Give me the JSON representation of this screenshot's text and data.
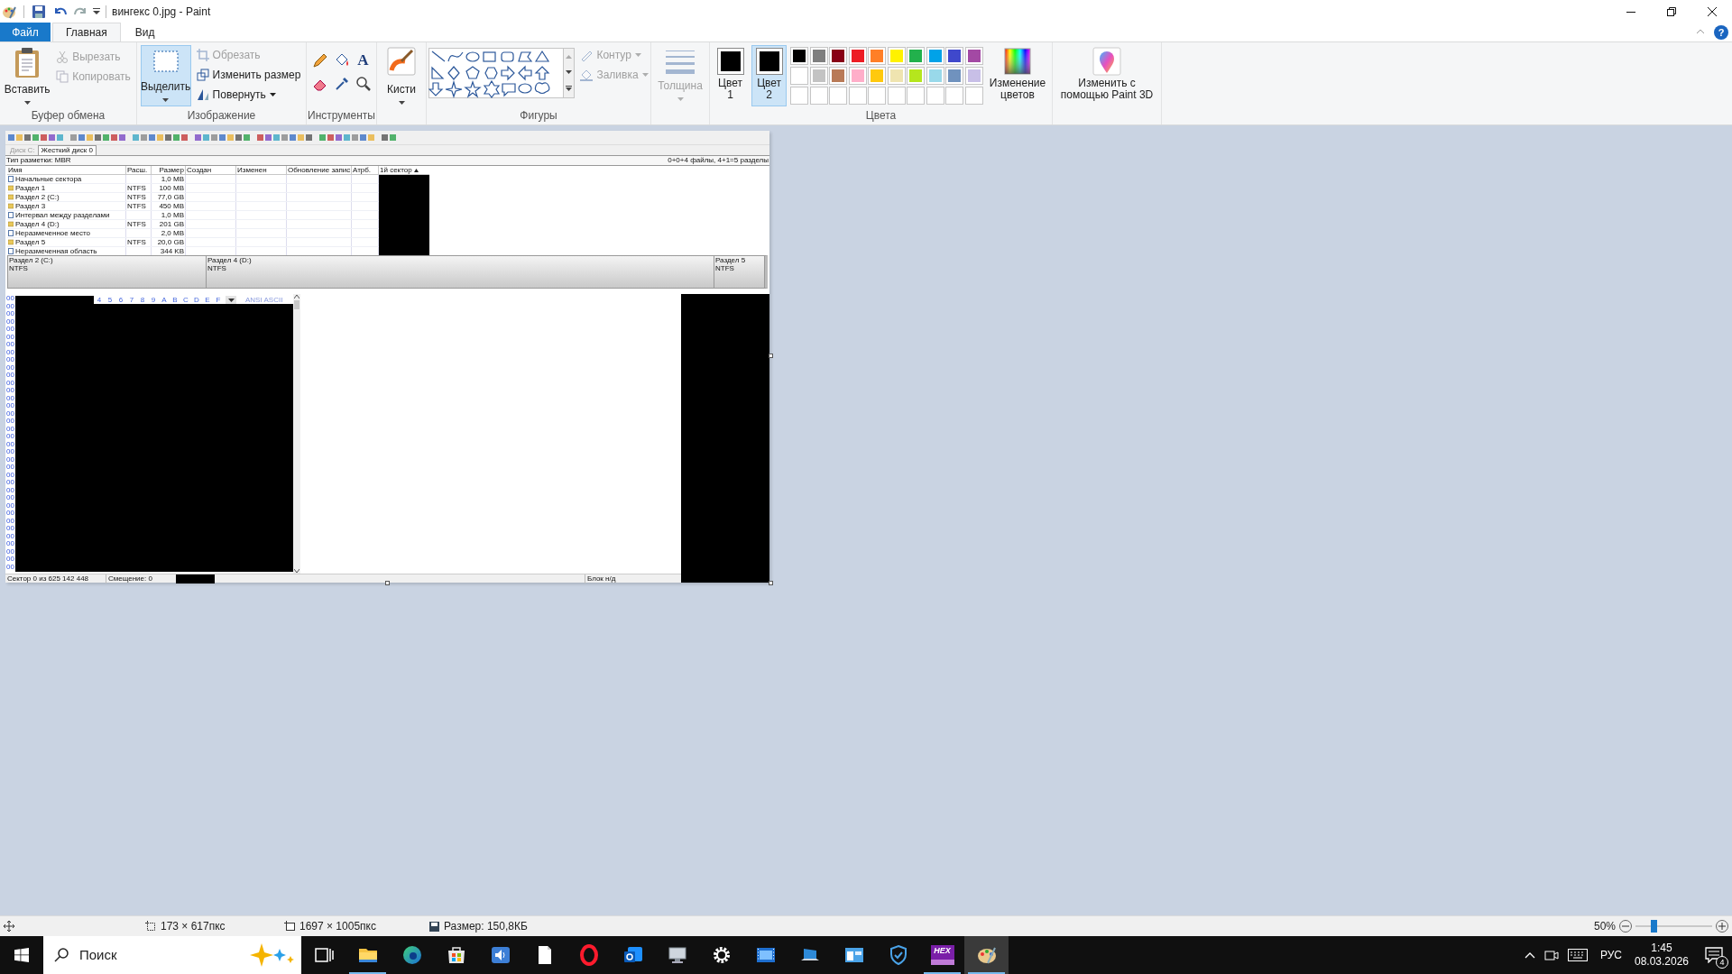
{
  "window": {
    "title": "вингекс 0.jpg - Paint",
    "help": "?"
  },
  "menu_tabs": [
    {
      "label": "Файл",
      "kind": "file",
      "selected": false
    },
    {
      "label": "Главная",
      "kind": "tab",
      "selected": true
    },
    {
      "label": "Вид",
      "kind": "tab",
      "selected": false
    }
  ],
  "clipboard": {
    "label": "Буфер обмена",
    "paste": "Вставить",
    "cut": {
      "label": "Вырезать",
      "disabled": true
    },
    "copy": {
      "label": "Копировать",
      "disabled": true
    }
  },
  "image": {
    "label": "Изображение",
    "select": {
      "label": "Выделить",
      "selected": true
    },
    "crop": {
      "label": "Обрезать",
      "disabled": true
    },
    "resize": {
      "label": "Изменить размер",
      "disabled": false
    },
    "rotate": {
      "label": "Повернуть",
      "disabled": false
    }
  },
  "tools": {
    "label": "Инструменты",
    "text_tool": "A"
  },
  "brushes": {
    "button": "Кисти"
  },
  "shapes": {
    "label": "Фигуры",
    "outline": {
      "label": "Контур",
      "disabled": true
    },
    "fill": {
      "label": "Заливка",
      "disabled": true
    }
  },
  "size": {
    "button": "Толщина",
    "disabled": true
  },
  "colors": {
    "label": "Цвета",
    "color1": {
      "label": "Цвет 1",
      "color": "#000000",
      "selected": false
    },
    "color2": {
      "label": "Цвет 2",
      "color": "#000000",
      "selected": true
    },
    "palette": [
      {
        "kind": "color",
        "color": "#000000"
      },
      {
        "kind": "color",
        "color": "#7f7f7f"
      },
      {
        "kind": "color",
        "color": "#880015"
      },
      {
        "kind": "color",
        "color": "#ed1c24"
      },
      {
        "kind": "color",
        "color": "#ff7f27"
      },
      {
        "kind": "color",
        "color": "#fff200"
      },
      {
        "kind": "color",
        "color": "#22b14c"
      },
      {
        "kind": "color",
        "color": "#00a2e8"
      },
      {
        "kind": "color",
        "color": "#3f48cc"
      },
      {
        "kind": "color",
        "color": "#a349a4"
      },
      {
        "kind": "color",
        "color": "#ffffff"
      },
      {
        "kind": "color",
        "color": "#c3c3c3"
      },
      {
        "kind": "color",
        "color": "#b97a57"
      },
      {
        "kind": "color",
        "color": "#ffaec9"
      },
      {
        "kind": "color",
        "color": "#ffc90e"
      },
      {
        "kind": "color",
        "color": "#efe4b0"
      },
      {
        "kind": "color",
        "color": "#b5e61d"
      },
      {
        "kind": "color",
        "color": "#99d9ea"
      },
      {
        "kind": "color",
        "color": "#7092be"
      },
      {
        "kind": "color",
        "color": "#c8bfe7"
      },
      {
        "kind": "empty"
      },
      {
        "kind": "empty"
      },
      {
        "kind": "empty"
      },
      {
        "kind": "empty"
      },
      {
        "kind": "empty"
      },
      {
        "kind": "empty"
      },
      {
        "kind": "empty"
      },
      {
        "kind": "empty"
      },
      {
        "kind": "empty"
      },
      {
        "kind": "empty"
      }
    ],
    "edit": "Изменение цветов"
  },
  "paint3d": {
    "label": "Изменить с помощью Paint 3D"
  },
  "canvas": {
    "tabs": [
      {
        "label": "Диск C:",
        "selected": false
      },
      {
        "label": "Жесткий диск 0",
        "selected": true
      }
    ],
    "partition_type": "Тип разметки: MBR",
    "summary": "0+0+4 файлы, 4+1=5 разделы",
    "columns": [
      "Имя",
      "Расш.",
      "Размер",
      "Создан",
      "Изменен",
      "Обновление запис",
      "Атрб."
    ],
    "sector_column": "1й сектор",
    "rows": [
      {
        "kind": "file",
        "name": "Начальные сектора",
        "size": "1,0 MB"
      },
      {
        "kind": "partition",
        "name": "Раздел 1",
        "ext": "NTFS",
        "size": "100 MB"
      },
      {
        "kind": "partition",
        "name": "Раздел 2 (C:)",
        "ext": "NTFS",
        "size": "77,0 GB"
      },
      {
        "kind": "partition",
        "name": "Раздел 3",
        "ext": "NTFS",
        "size": "450 MB"
      },
      {
        "kind": "file",
        "name": "Интервал между разделами",
        "size": "1,0 MB"
      },
      {
        "kind": "partition",
        "name": "Раздел 4 (D:)",
        "ext": "NTFS",
        "size": "201 GB"
      },
      {
        "kind": "file",
        "name": "Неразмеченное место",
        "size": "2,0 MB"
      },
      {
        "kind": "partition",
        "name": "Раздел 5",
        "ext": "NTFS",
        "size": "20,0 GB"
      },
      {
        "kind": "file",
        "name": "Неразмеченная область",
        "size": "344 KB"
      }
    ],
    "partitions": [
      {
        "label": "Раздел 2 (C:)",
        "fs": "NTFS"
      },
      {
        "label": "Раздел 4 (D:)",
        "fs": "NTFS"
      },
      {
        "label": "Раздел 5",
        "fs": "NTFS"
      }
    ],
    "hex_digits": [
      "4",
      "5",
      "6",
      "7",
      "8",
      "9",
      "A",
      "B",
      "C",
      "D",
      "E",
      "F"
    ],
    "text_header": "ANSI ASCII",
    "offsets": [
      "00",
      "00",
      "00",
      "00",
      "00",
      "00",
      "00",
      "00",
      "00",
      "00",
      "00",
      "00",
      "00",
      "00",
      "00",
      "00",
      "00",
      "00",
      "00",
      "00",
      "00",
      "00",
      "00",
      "00",
      "00",
      "00",
      "00",
      "00",
      "00",
      "00",
      "00",
      "00",
      "00",
      "00",
      "00",
      "00"
    ],
    "status": {
      "sector": "Сектор 0 из 625 142 448",
      "offset": "Смещение: 0",
      "block": "Блок н/д"
    }
  },
  "status_bar": {
    "selection_size": "173 × 617пкс",
    "image_size": "1697 × 1005пкс",
    "file_size": "Размер: 150,8КБ",
    "zoom": "50%",
    "zoom_slider": {
      "level": 0.24
    }
  },
  "taskbar": {
    "search": "Поиск",
    "apps": [
      {
        "kind": "taskview",
        "running": false,
        "selected": false
      },
      {
        "kind": "folder",
        "running": true,
        "selected": false
      },
      {
        "kind": "browser",
        "running": false,
        "selected": false
      },
      {
        "kind": "store",
        "running": false,
        "selected": false
      },
      {
        "kind": "speaker",
        "running": false,
        "selected": false
      },
      {
        "kind": "document",
        "running": false,
        "selected": false
      },
      {
        "kind": "ring",
        "running": false,
        "selected": false
      },
      {
        "kind": "mail",
        "running": false,
        "selected": false
      },
      {
        "kind": "monitor",
        "running": false,
        "selected": false
      },
      {
        "kind": "gear",
        "running": false,
        "selected": false
      },
      {
        "kind": "film",
        "running": false,
        "selected": false
      },
      {
        "kind": "laptop",
        "running": false,
        "selected": false
      },
      {
        "kind": "window",
        "running": false,
        "selected": false
      },
      {
        "kind": "shield",
        "running": false,
        "selected": false
      },
      {
        "kind": "hex",
        "label": "HEX",
        "running": true,
        "selected": false
      },
      {
        "kind": "palette",
        "running": true,
        "selected": true
      }
    ],
    "language": "РУС",
    "time": "1:45",
    "date": "08.03.2026",
    "notifications": "4"
  }
}
